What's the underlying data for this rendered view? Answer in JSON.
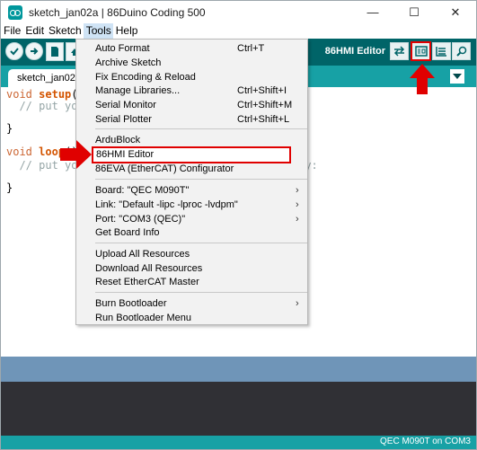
{
  "window": {
    "title": "sketch_jan02a | 86Duino Coding 500",
    "controls": {
      "minimize": "—",
      "maximize": "☐",
      "close": "✕"
    }
  },
  "menubar": {
    "items": [
      "File",
      "Edit",
      "Sketch",
      "Tools",
      "Help"
    ],
    "active": "Tools"
  },
  "toolbar": {
    "label": "86HMI Editor",
    "left_buttons": [
      "verify-icon",
      "upload-icon",
      "new-icon",
      "open-icon",
      "save-icon"
    ],
    "right_buttons": [
      "sync-icon",
      "hmi-editor-icon",
      "list-icon",
      "serial-monitor-icon"
    ]
  },
  "tabs": {
    "items": [
      "sketch_jan02a"
    ]
  },
  "editor": {
    "lines": [
      {
        "type": "void",
        "fn": "setup",
        "rest": "() {"
      },
      {
        "comment": "  // put your main code here, to run once:"
      },
      {
        "plain": ""
      },
      {
        "plain": "}"
      },
      {
        "plain": ""
      },
      {
        "type": "void",
        "fn": "loop",
        "rest": "() {"
      },
      {
        "comment": "  // put your main code here, to run repeatedly:"
      },
      {
        "plain": ""
      },
      {
        "plain": "}"
      }
    ]
  },
  "tools_menu": {
    "items": [
      {
        "label": "Auto Format",
        "shortcut": "Ctrl+T"
      },
      {
        "label": "Archive Sketch"
      },
      {
        "label": "Fix Encoding & Reload"
      },
      {
        "label": "Manage Libraries...",
        "shortcut": "Ctrl+Shift+I"
      },
      {
        "label": "Serial Monitor",
        "shortcut": "Ctrl+Shift+M"
      },
      {
        "label": "Serial Plotter",
        "shortcut": "Ctrl+Shift+L"
      },
      {
        "label": "ArduBlock"
      },
      {
        "label": "86HMI Editor",
        "highlighted": true
      },
      {
        "label": "86EVA (EtherCAT) Configurator"
      },
      {
        "label": "Board: \"QEC M090T\"",
        "submenu": true
      },
      {
        "label": "Link: \"Default -lipc -lproc -lvdpm\"",
        "submenu": true
      },
      {
        "label": "Port: \"COM3 (QEC)\"",
        "submenu": true
      },
      {
        "label": "Get Board Info"
      },
      {
        "label": "Upload All Resources"
      },
      {
        "label": "Download All Resources"
      },
      {
        "label": "Reset EtherCAT Master"
      },
      {
        "label": "Burn Bootloader",
        "submenu": true
      },
      {
        "label": "Run Bootloader Menu"
      }
    ]
  },
  "status": {
    "board_port": "QEC M090T on COM3"
  },
  "colors": {
    "toolbar": "#006468",
    "tabbar": "#17a1a5",
    "console_strip": "#6f95b8",
    "console": "#303035",
    "highlight_red": "#e00000"
  }
}
